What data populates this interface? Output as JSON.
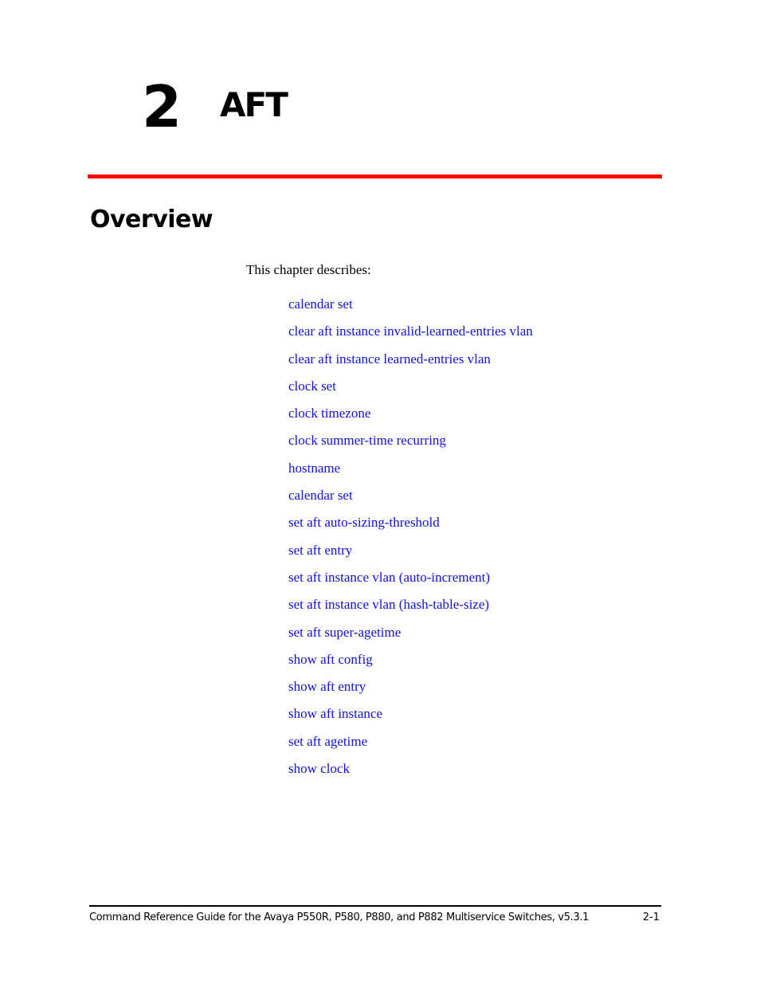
{
  "chapter": {
    "number": "2",
    "title": "AFT"
  },
  "colors": {
    "rule": "#ff0000",
    "link": "#1010e0"
  },
  "overview": {
    "heading": "Overview",
    "intro": "This chapter describes:",
    "topics": [
      "calendar set",
      "clear aft instance invalid-learned-entries vlan",
      "clear aft instance learned-entries vlan",
      "clock set",
      "clock timezone",
      "clock summer-time recurring",
      "hostname",
      "calendar set",
      "set aft auto-sizing-threshold",
      "set aft entry",
      "set aft instance vlan (auto-increment)",
      "set aft instance vlan (hash-table-size)",
      "set aft super-agetime",
      "show aft config",
      "show aft entry",
      "show aft instance",
      "set aft agetime",
      "show clock"
    ]
  },
  "footer": {
    "text": "Command Reference Guide for the Avaya P550R, P580, P880, and P882 Multiservice Switches, v5.3.1",
    "page": "2-1"
  }
}
